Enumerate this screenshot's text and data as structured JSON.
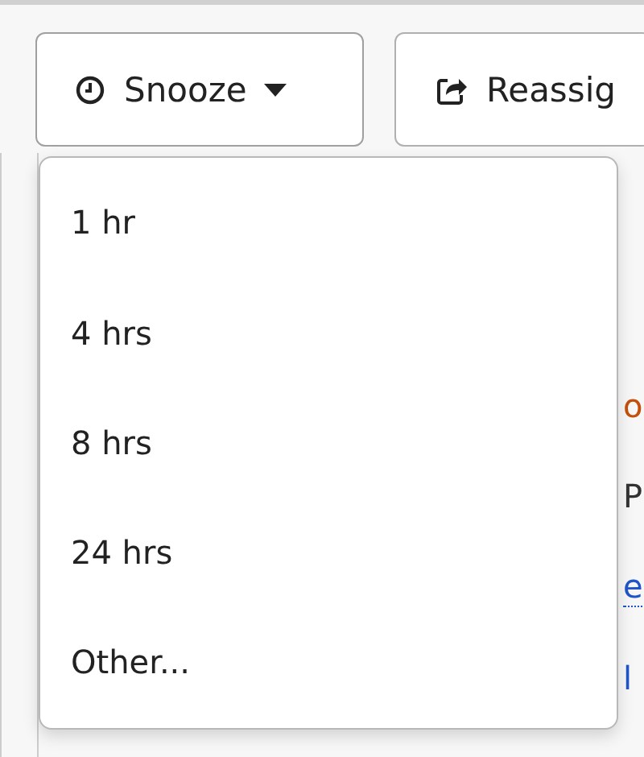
{
  "toolbar": [
    {
      "label": "Snooze",
      "kind": "snooze",
      "dropdown": true,
      "expanded": true
    },
    {
      "label": "Reassig",
      "kind": "reassign",
      "dropdown": false,
      "expanded": false
    }
  ],
  "snooze_menu": [
    {
      "label": "1 hr"
    },
    {
      "label": "4 hrs"
    },
    {
      "label": "8 hrs"
    },
    {
      "label": "24 hrs"
    },
    {
      "label": "Other..."
    }
  ],
  "background_fragments": [
    {
      "text": "o",
      "kind": "text",
      "color": "#c4500c"
    },
    {
      "text": "P",
      "kind": "text",
      "color": "#333333"
    },
    {
      "text": "e",
      "kind": "link",
      "color": "#1f55c8"
    },
    {
      "text": "l",
      "kind": "text",
      "color": "#1f55c8"
    }
  ]
}
